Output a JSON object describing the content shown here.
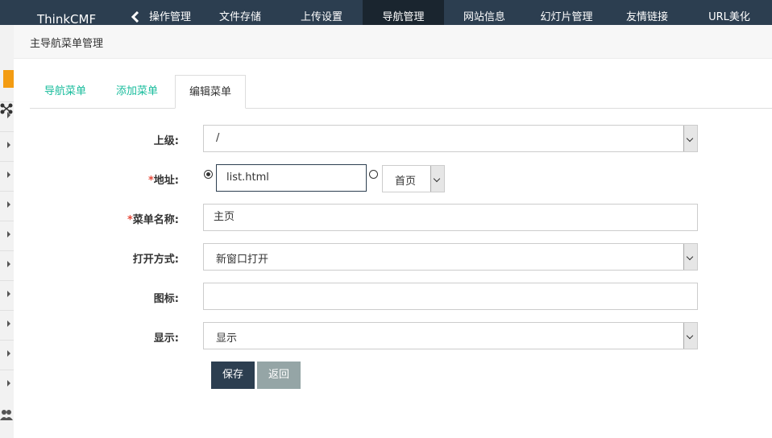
{
  "topbar": {
    "brand": "ThinkCMF",
    "nav": [
      "操作管理",
      "文件存储",
      "上传设置",
      "导航管理",
      "网站信息",
      "幻灯片管理",
      "友情链接",
      "URL美化"
    ],
    "active_index": 3
  },
  "panel": {
    "title": "主导航菜单管理",
    "tabs": [
      "导航菜单",
      "添加菜单",
      "编辑菜单"
    ],
    "active_tab": 2
  },
  "form": {
    "parent": {
      "label": "上级:",
      "value": "/"
    },
    "address": {
      "required": "*",
      "label": "地址:",
      "url_value": "list.html",
      "page_value": "首页"
    },
    "name": {
      "required": "*",
      "label": "菜单名称:",
      "value": "主页"
    },
    "open_mode": {
      "label": "打开方式:",
      "value": "新窗口打开"
    },
    "icon": {
      "label": "图标:",
      "value": ""
    },
    "display": {
      "label": "显示:",
      "value": "显示"
    }
  },
  "buttons": {
    "save": "保存",
    "back": "返回"
  },
  "colors": {
    "topbar": "#2c3e50",
    "tab_link": "#18bc9c",
    "required": "#e74c3c",
    "primary": "#2c3e50",
    "muted": "#95a5a6",
    "home": "#f39c12"
  }
}
